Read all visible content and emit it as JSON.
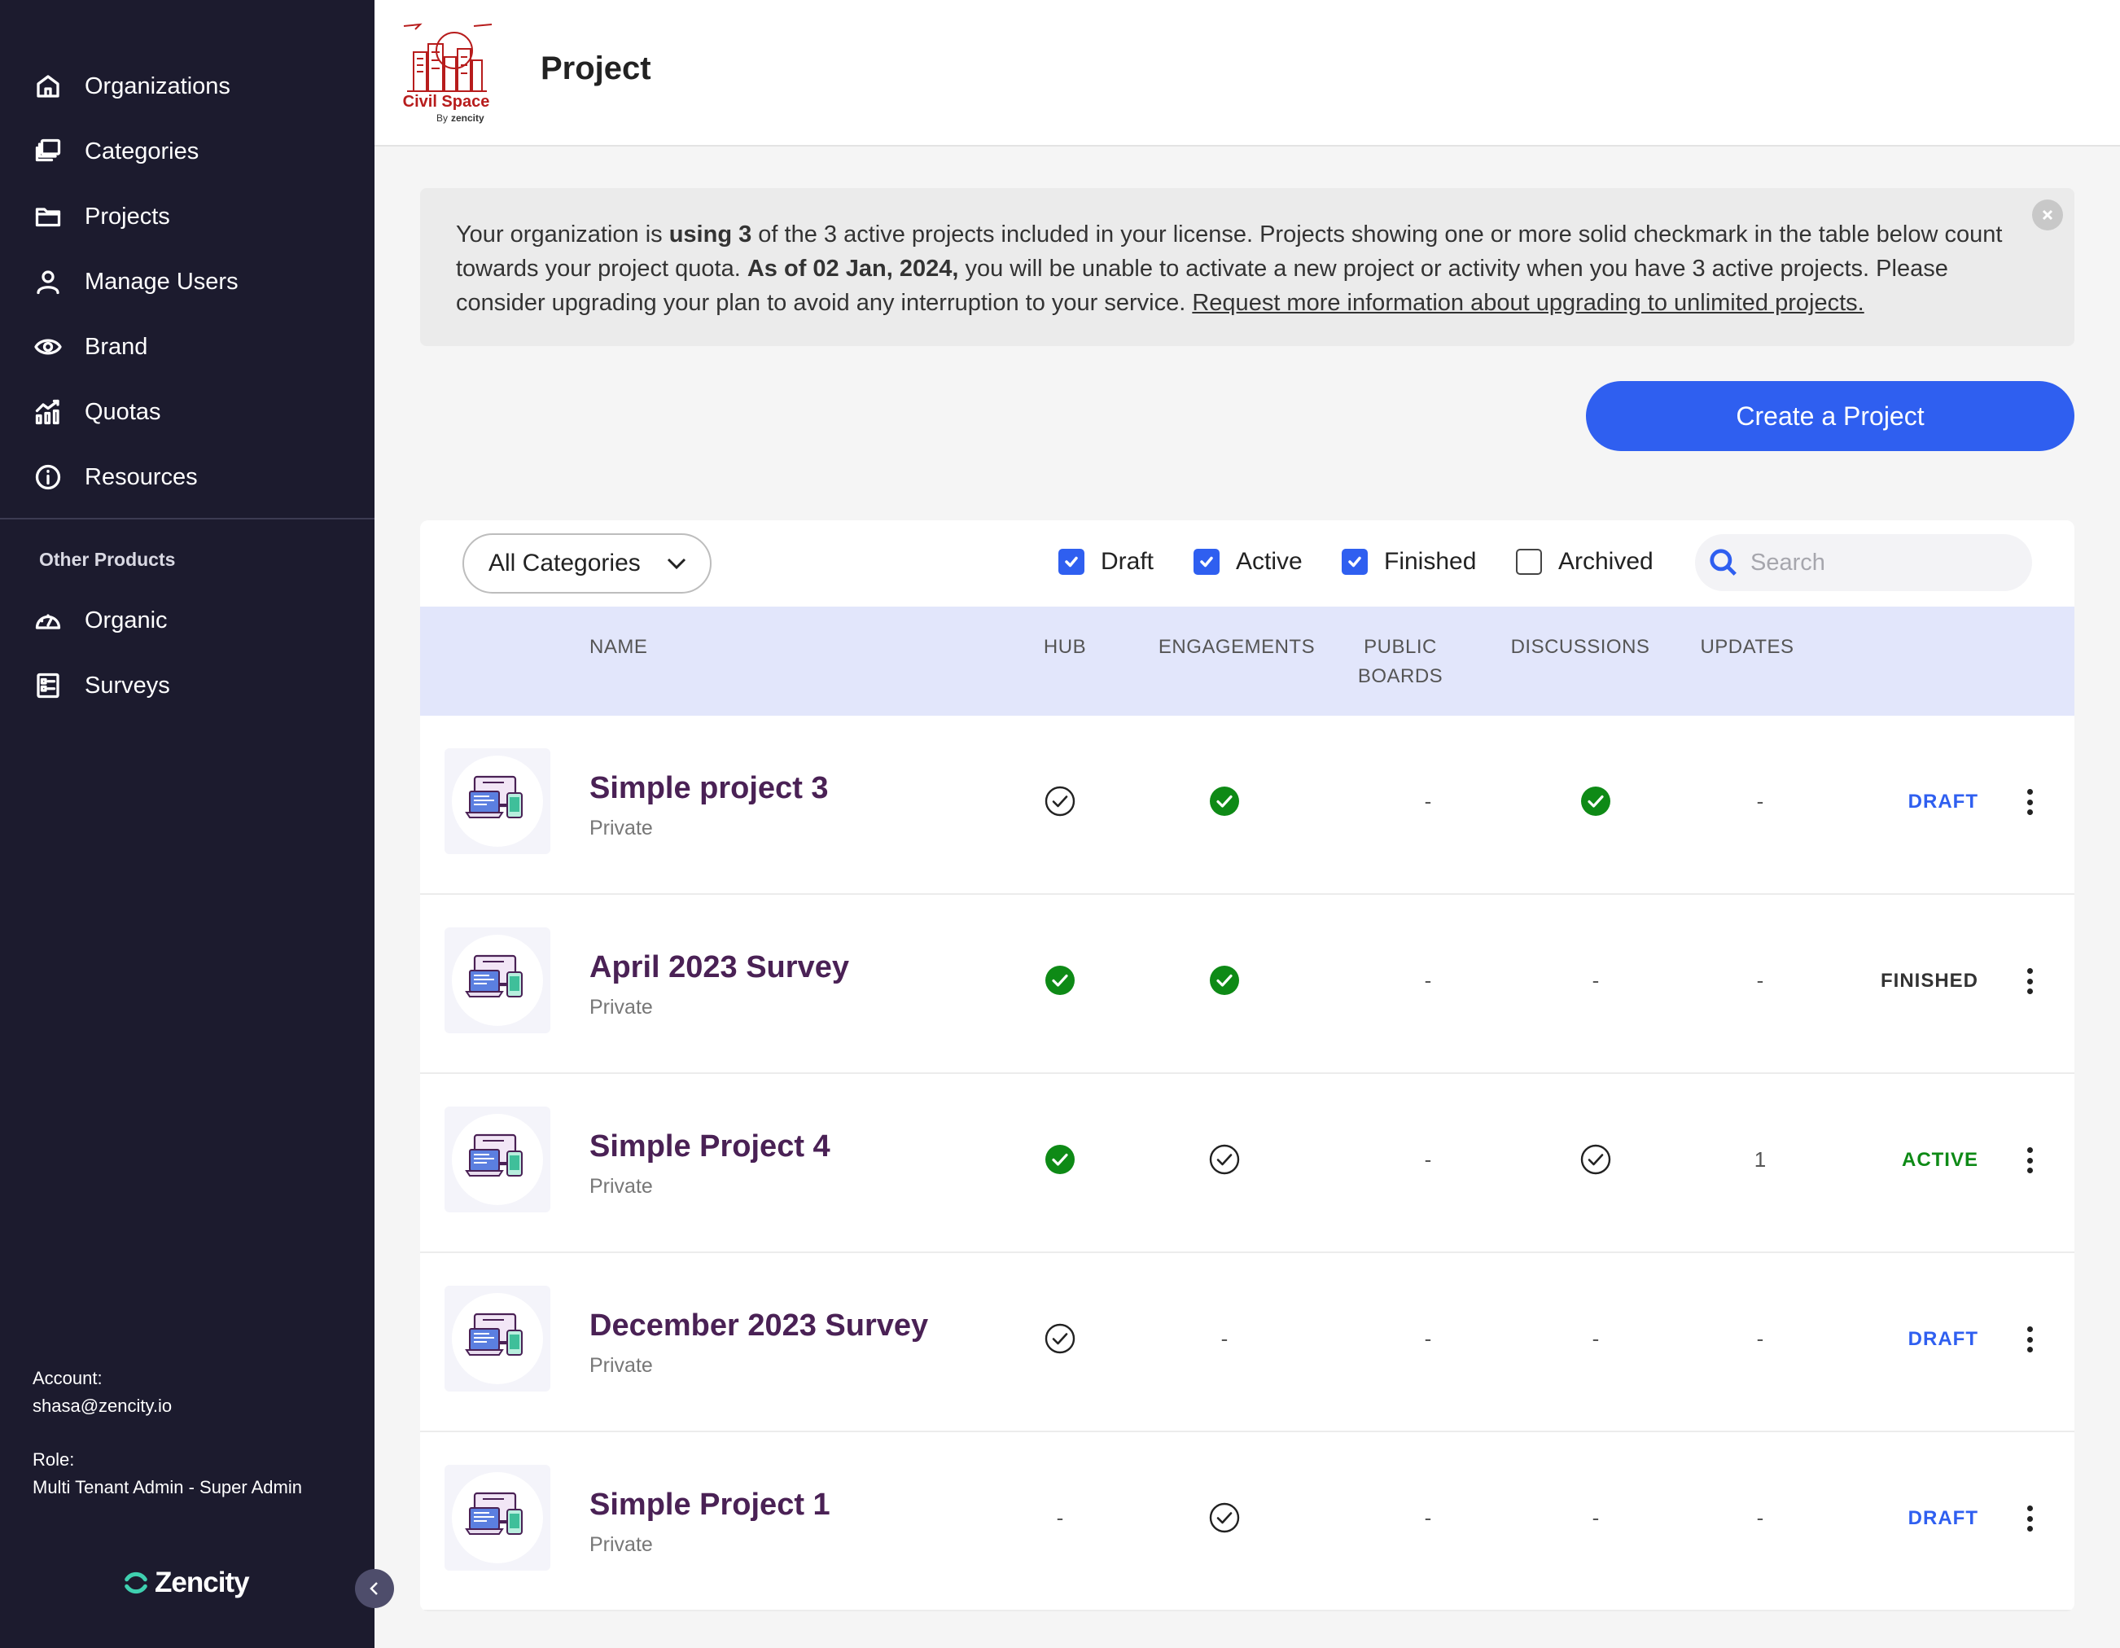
{
  "sidebar": {
    "nav": [
      {
        "label": "Organizations",
        "icon": "home-icon"
      },
      {
        "label": "Categories",
        "icon": "categories-icon"
      },
      {
        "label": "Projects",
        "icon": "folder-icon"
      },
      {
        "label": "Manage Users",
        "icon": "user-icon"
      },
      {
        "label": "Brand",
        "icon": "eye-icon"
      },
      {
        "label": "Quotas",
        "icon": "chart-icon"
      },
      {
        "label": "Resources",
        "icon": "info-icon"
      }
    ],
    "other_title": "Other Products",
    "other": [
      {
        "label": "Organic",
        "icon": "gauge-icon"
      },
      {
        "label": "Surveys",
        "icon": "survey-icon"
      }
    ],
    "account_label": "Account:",
    "account_value": "shasa@zencity.io",
    "role_label": "Role:",
    "role_value": "Multi Tenant Admin - Super Admin",
    "brand": "Zencity"
  },
  "header": {
    "title": "Project",
    "logo_name": "Civil Space",
    "logo_by": "By",
    "logo_company": "zencity"
  },
  "notice": {
    "p1": "Your organization is ",
    "b1": "using 3",
    "p2": " of the 3 active projects included in your license. Projects showing one or more solid checkmark in the table below count towards your project quota. ",
    "b2": "As of 02 Jan, 2024,",
    "p3": " you will be unable to activate a new project or activity when you have 3 active projects. Please consider upgrading your plan to avoid any interruption to your service. ",
    "link": "Request more information about upgrading to unlimited projects."
  },
  "create_button": "Create a Project",
  "filters": {
    "category": "All Categories",
    "checkboxes": [
      {
        "label": "Draft",
        "checked": true
      },
      {
        "label": "Active",
        "checked": true
      },
      {
        "label": "Finished",
        "checked": true
      },
      {
        "label": "Archived",
        "checked": false
      }
    ],
    "search_placeholder": "Search"
  },
  "columns": {
    "name": "NAME",
    "hub": "HUB",
    "engagements": "ENGAGEMENTS",
    "public_boards_1": "PUBLIC",
    "public_boards_2": "BOARDS",
    "discussions": "DISCUSSIONS",
    "updates": "UPDATES"
  },
  "colors": {
    "accent": "#2f5ff0",
    "success": "#0e8a16",
    "draft": "#2f5ff0",
    "active": "#0e8a16",
    "finished": "#333333",
    "sidebar": "#1c1b2e",
    "project_name": "#4a2155"
  },
  "rows": [
    {
      "name": "Simple project 3",
      "visibility": "Private",
      "hub": "outline",
      "engagements": "solid",
      "public_boards": "-",
      "discussions": "solid",
      "updates": "-",
      "status": "DRAFT",
      "status_type": "draft"
    },
    {
      "name": "April 2023 Survey",
      "visibility": "Private",
      "hub": "solid",
      "engagements": "solid",
      "public_boards": "-",
      "discussions": "-",
      "updates": "-",
      "status": "FINISHED",
      "status_type": "finished"
    },
    {
      "name": "Simple Project 4",
      "visibility": "Private",
      "hub": "solid",
      "engagements": "outline",
      "public_boards": "-",
      "discussions": "outline",
      "updates": "1",
      "status": "ACTIVE",
      "status_type": "active"
    },
    {
      "name": "December 2023 Survey",
      "visibility": "Private",
      "hub": "outline",
      "engagements": "-",
      "public_boards": "-",
      "discussions": "-",
      "updates": "-",
      "status": "DRAFT",
      "status_type": "draft"
    },
    {
      "name": "Simple Project 1",
      "visibility": "Private",
      "hub": "-",
      "engagements": "outline",
      "public_boards": "-",
      "discussions": "-",
      "updates": "-",
      "status": "DRAFT",
      "status_type": "draft"
    }
  ]
}
